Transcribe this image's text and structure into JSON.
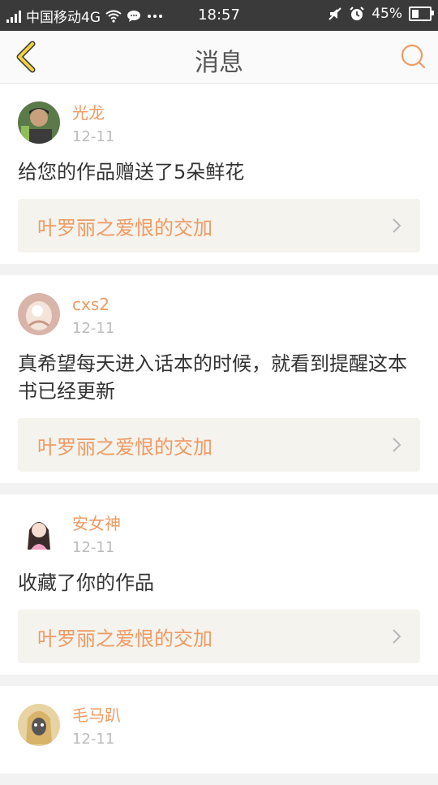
{
  "status": {
    "carrier": "中国移动4G",
    "time": "18:57",
    "battery": "45%"
  },
  "header": {
    "title": "消息"
  },
  "colors": {
    "accent": "#ef9a63",
    "back_icon": "#f0d23c"
  },
  "messages": [
    {
      "name": "光龙",
      "date": "12-11",
      "text": "给您的作品赠送了5朵鲜花",
      "work": "叶罗丽之爱恨的交加"
    },
    {
      "name": "cxs2",
      "date": "12-11",
      "text": "真希望每天进入话本的时候，就看到提醒这本书已经更新",
      "work": "叶罗丽之爱恨的交加"
    },
    {
      "name": "安女神",
      "date": "12-11",
      "text": "收藏了你的作品",
      "work": "叶罗丽之爱恨的交加"
    },
    {
      "name": "毛马趴",
      "date": "12-11"
    }
  ]
}
